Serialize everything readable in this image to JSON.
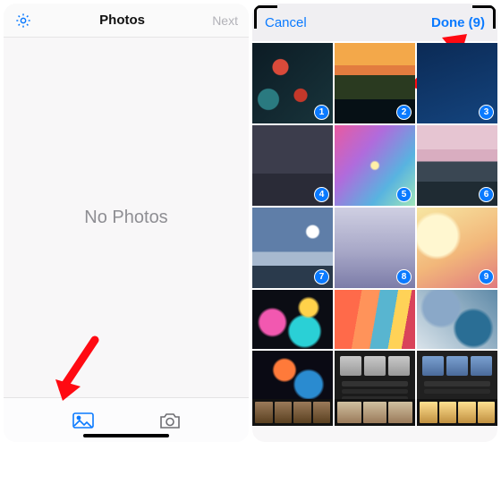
{
  "left": {
    "title": "Photos",
    "next": "Next",
    "settings_icon": "gear-icon",
    "empty_text": "No Photos",
    "tabs": {
      "library_icon": "photo-library-icon",
      "camera_icon": "camera-icon"
    }
  },
  "right": {
    "cancel": "Cancel",
    "done": "Done (9)",
    "selected_count": 9,
    "thumbs": [
      {
        "id": 1,
        "selected": true,
        "badge": "1"
      },
      {
        "id": 2,
        "selected": true,
        "badge": "2"
      },
      {
        "id": 3,
        "selected": true,
        "badge": "3"
      },
      {
        "id": 4,
        "selected": true,
        "badge": "4"
      },
      {
        "id": 5,
        "selected": true,
        "badge": "5"
      },
      {
        "id": 6,
        "selected": true,
        "badge": "6"
      },
      {
        "id": 7,
        "selected": true,
        "badge": "7"
      },
      {
        "id": 8,
        "selected": true,
        "badge": "8"
      },
      {
        "id": 9,
        "selected": true,
        "badge": "9"
      },
      {
        "id": 10,
        "selected": false
      },
      {
        "id": 11,
        "selected": false
      },
      {
        "id": 12,
        "selected": false
      },
      {
        "id": 13,
        "selected": false
      },
      {
        "id": 14,
        "selected": false
      },
      {
        "id": 15,
        "selected": false
      }
    ]
  },
  "colors": {
    "ios_blue": "#0a7aff",
    "arrow_red": "#ff0a12"
  }
}
